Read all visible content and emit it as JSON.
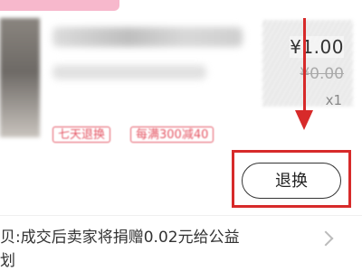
{
  "order_item": {
    "price": "¥1.00",
    "original_price": "¥0.00",
    "quantity": "x1",
    "tags": [
      "七天退换",
      "每满300减40"
    ]
  },
  "actions": {
    "return_exchange_label": "退换"
  },
  "charity_note": {
    "line1": "贝:成交后卖家将捐赠0.02元给公益",
    "line2": "划"
  },
  "colors": {
    "annotation_red": "#d72a2a",
    "tag_red": "#e45563",
    "pink_banner": "#f7b8cc"
  },
  "icons": {
    "annotation_arrow": "down-arrow-icon",
    "chevron": "chevron-right-icon"
  }
}
